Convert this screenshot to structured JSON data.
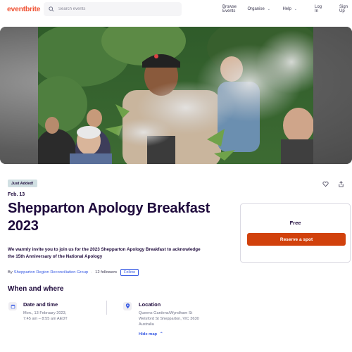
{
  "header": {
    "logo": "eventbrite",
    "search_placeholder": "Search events",
    "nav": {
      "browse": "Browse Events",
      "organise": "Organise",
      "help": "Help",
      "login": "Log In",
      "signup": "Sign Up"
    }
  },
  "event": {
    "badge": "Just Added!",
    "date_short": "Feb. 13",
    "title": "Shepparton Apology Breakfast 2023",
    "description": "We warmly invite you to join us for the 2023 Shepparton Apology Breakfast to acknowledge the 15th Anniversary of the National Apology",
    "organizer": {
      "by": "By",
      "name": "Shepparton Region Reconciliation Group",
      "followers": "12 followers",
      "follow_label": "Follow"
    }
  },
  "when_where": {
    "heading": "When and where",
    "date_time": {
      "title": "Date and time",
      "line1": "Mon., 13 February 2023,",
      "line2": "7:45 am – 8:55 am AEDT"
    },
    "location": {
      "title": "Location",
      "line1": "Queens Gardens/Wyndham St",
      "line2": "Welsford St Shepparton, VIC 3630",
      "line3": "Australia",
      "hide_map": "Hide map"
    }
  },
  "ticket": {
    "price": "Free",
    "reserve_label": "Reserve a spot"
  },
  "icons": {
    "search": "search-icon",
    "like": "heart-icon",
    "share": "share-icon",
    "calendar": "calendar-icon",
    "location": "location-pin-icon"
  },
  "colors": {
    "brand": "#f05537",
    "cta": "#d1410c",
    "link": "#3659e3",
    "text": "#1e0a3c"
  }
}
